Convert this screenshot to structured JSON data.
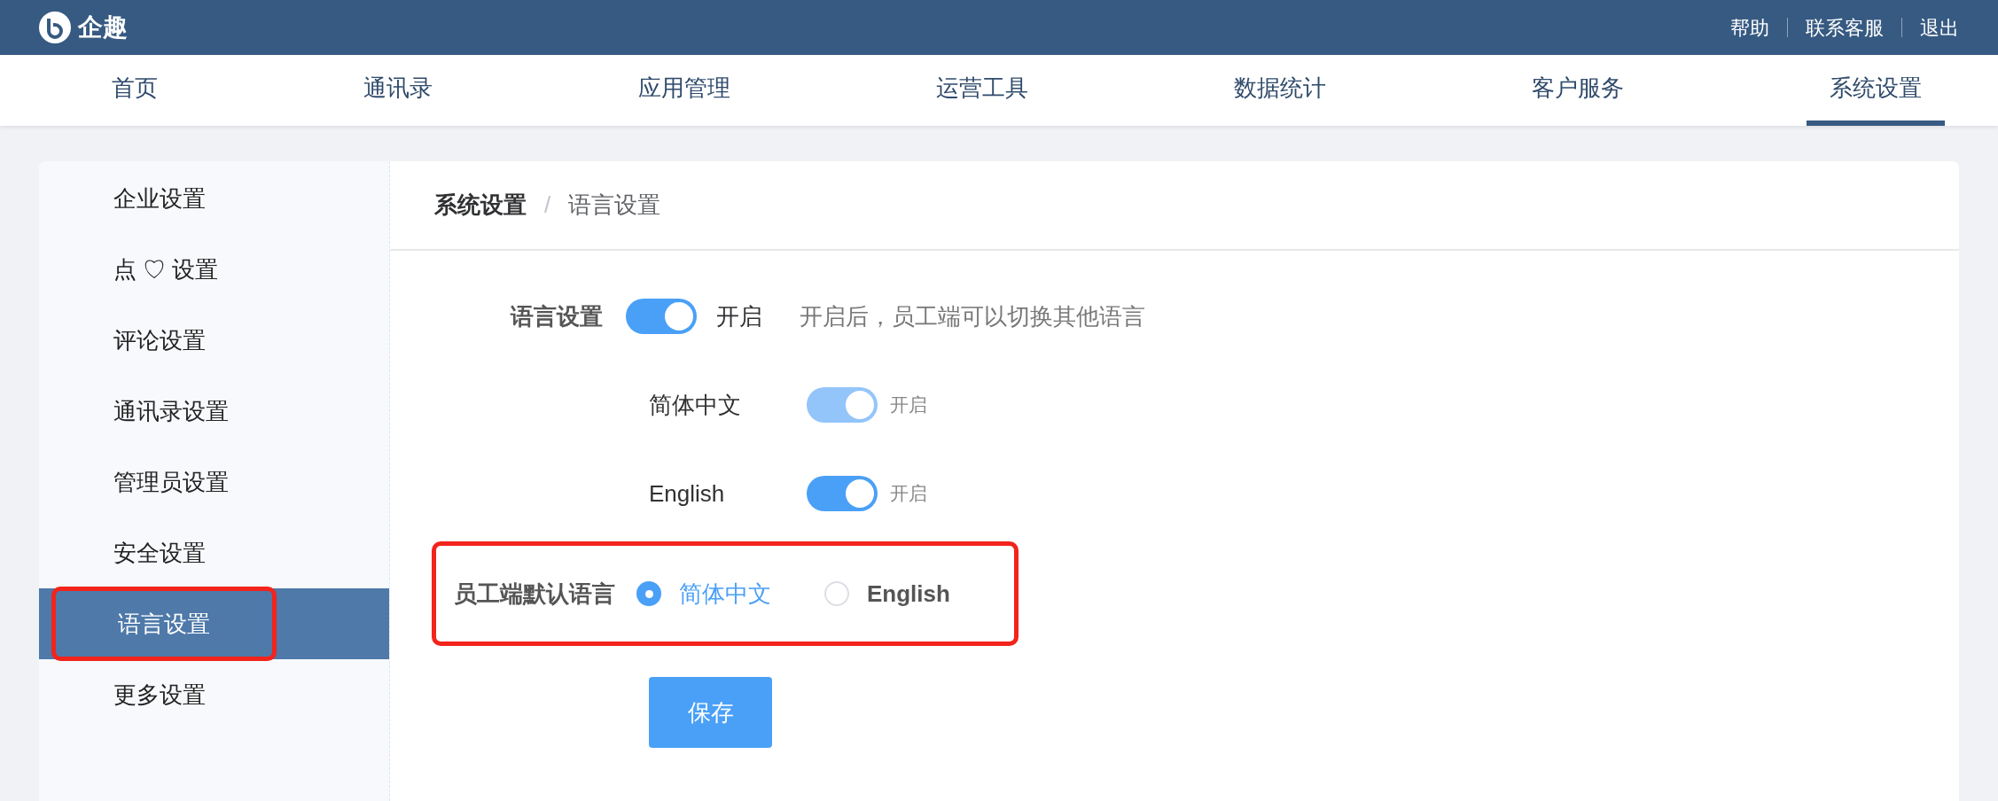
{
  "header": {
    "brand": "企趣",
    "links": [
      "帮助",
      "联系客服",
      "退出"
    ]
  },
  "nav": [
    {
      "label": "首页",
      "selected": false
    },
    {
      "label": "通讯录",
      "selected": false
    },
    {
      "label": "应用管理",
      "selected": false
    },
    {
      "label": "运营工具",
      "selected": false
    },
    {
      "label": "数据统计",
      "selected": false
    },
    {
      "label": "客户服务",
      "selected": false
    },
    {
      "label": "系统设置",
      "selected": true
    }
  ],
  "sidebar": {
    "items": [
      {
        "label": "企业设置",
        "selected": false,
        "highlighted": false
      },
      {
        "label": "点 ♡ 设置",
        "selected": false,
        "highlighted": false
      },
      {
        "label": "评论设置",
        "selected": false,
        "highlighted": false
      },
      {
        "label": "通讯录设置",
        "selected": false,
        "highlighted": false
      },
      {
        "label": "管理员设置",
        "selected": false,
        "highlighted": false
      },
      {
        "label": "安全设置",
        "selected": false,
        "highlighted": false
      },
      {
        "label": "语言设置",
        "selected": true,
        "highlighted": true
      },
      {
        "label": "更多设置",
        "selected": false,
        "highlighted": false
      }
    ]
  },
  "breadcrumb": {
    "items": [
      "系统设置",
      "语言设置"
    ],
    "separator": "/"
  },
  "language_setting": {
    "label": "语言设置",
    "on": true,
    "state_text": "开启",
    "hint": "开启后，员工端可以切换其他语言"
  },
  "languages": [
    {
      "name": "简体中文",
      "on": true,
      "disabled": true,
      "state_text": "开启"
    },
    {
      "name": "English",
      "on": true,
      "disabled": false,
      "state_text": "开启"
    }
  ],
  "default_language": {
    "label": "员工端默认语言",
    "highlighted": true,
    "options": [
      {
        "label": "简体中文",
        "selected": true
      },
      {
        "label": "English",
        "selected": false
      }
    ]
  },
  "save_button": "保存"
}
